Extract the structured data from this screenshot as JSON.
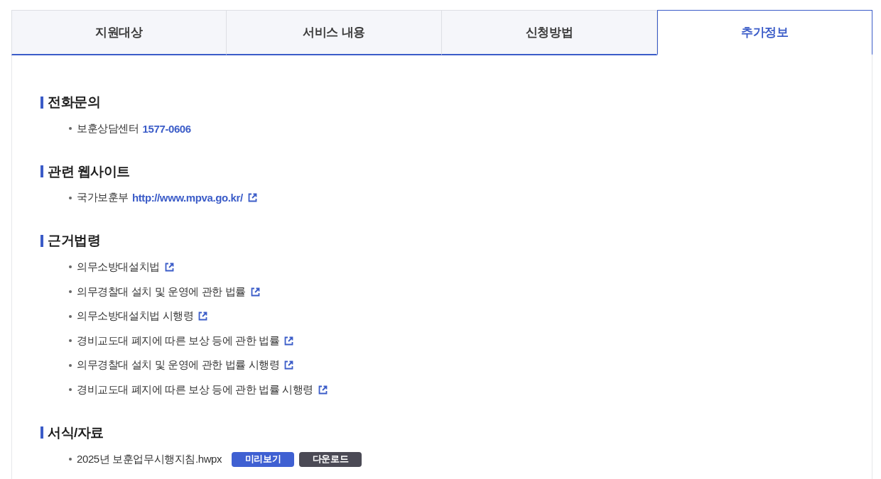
{
  "tabs": [
    {
      "label": "지원대상",
      "selected": false
    },
    {
      "label": "서비스 내용",
      "selected": false
    },
    {
      "label": "신청방법",
      "selected": false
    },
    {
      "label": "추가정보",
      "selected": true
    }
  ],
  "sections": [
    {
      "title": "전화문의",
      "items": [
        {
          "kind": "phone",
          "label": "보훈상담센터",
          "value": "1577-0606"
        }
      ]
    },
    {
      "title": "관련 웹사이트",
      "items": [
        {
          "kind": "website",
          "label": "국가보훈부",
          "value": "http://www.mpva.go.kr/"
        }
      ]
    },
    {
      "title": "근거법령",
      "items": [
        {
          "kind": "law",
          "label": "의무소방대설치법"
        },
        {
          "kind": "law",
          "label": "의무경찰대 설치 및 운영에 관한 법률"
        },
        {
          "kind": "law",
          "label": "의무소방대설치법 시행령"
        },
        {
          "kind": "law",
          "label": "경비교도대 폐지에 따른 보상 등에 관한 법률"
        },
        {
          "kind": "law",
          "label": "의무경찰대 설치 및 운영에 관한 법률 시행령"
        },
        {
          "kind": "law",
          "label": "경비교도대 폐지에 따른 보상 등에 관한 법률 시행령"
        }
      ]
    },
    {
      "title": "서식/자료",
      "items": [
        {
          "kind": "file",
          "label": "2025년 보훈업무시행지침.hwpx",
          "buttons": [
            {
              "kind": "preview",
              "label": "미리보기"
            },
            {
              "kind": "download",
              "label": "다운로드"
            }
          ]
        }
      ]
    }
  ]
}
